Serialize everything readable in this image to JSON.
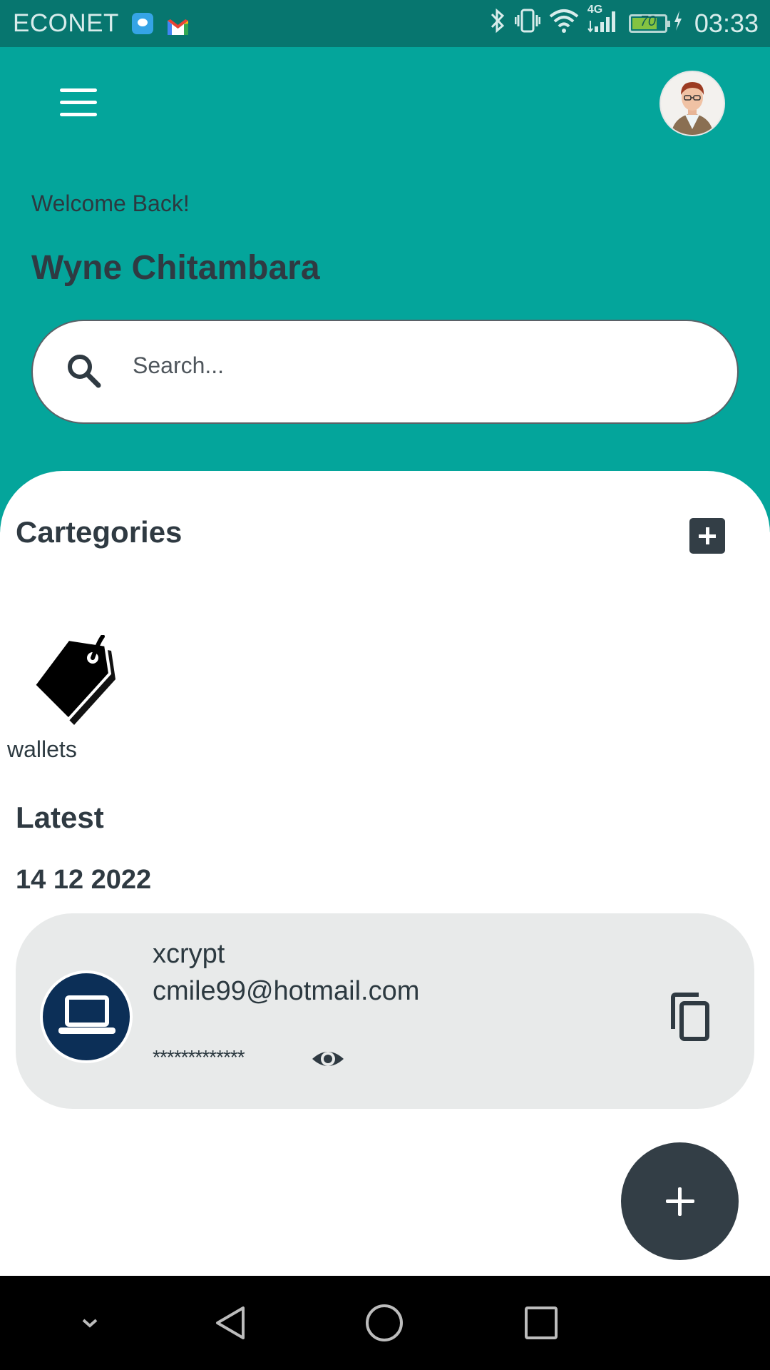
{
  "status_bar": {
    "carrier": "ECONET",
    "battery_level": "70",
    "network_type": "4G",
    "time": "03:33",
    "icons": [
      "chat-notification-icon",
      "gmail-icon",
      "bluetooth-icon",
      "vibrate-icon",
      "wifi-icon",
      "signal-icon",
      "battery-icon",
      "charging-icon"
    ]
  },
  "header": {
    "welcome_text": "Welcome Back!",
    "user_name": "Wyne Chitambara",
    "search_placeholder": "Search...",
    "colors": {
      "background": "#04a59b",
      "status_bar": "#07766f"
    }
  },
  "categories": {
    "title": "Cartegories",
    "items": [
      {
        "label": "wallets",
        "icon": "price-tag-icon"
      }
    ]
  },
  "latest": {
    "title": "Latest",
    "groups": [
      {
        "date": "14 12 2022",
        "entries": [
          {
            "name": "xcrypt",
            "email": "cmile99@hotmail.com",
            "password_masked": "*************",
            "icon": "laptop-icon"
          }
        ]
      }
    ]
  },
  "accent_color": "#333e46"
}
